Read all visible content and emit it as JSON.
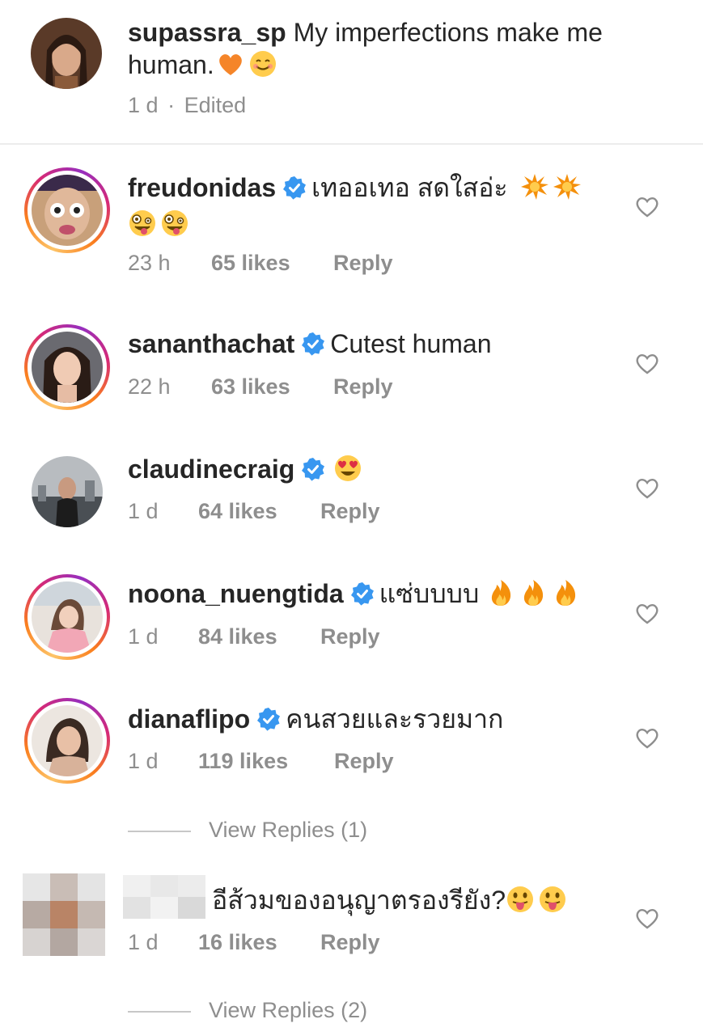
{
  "caption": {
    "username": "supassra_sp",
    "text_line1": "My imperfections make me",
    "text_line2": "human.",
    "time": "1 d",
    "separator": "·",
    "edited": "Edited"
  },
  "comments": [
    {
      "username": "freudonidas",
      "text_line1": "เทออเทอ สดใสอ่ะ",
      "time": "23 h",
      "likes": "65 likes",
      "reply": "Reply",
      "emojis": [
        "explosion-emoji",
        "explosion-emoji",
        "zany-face-emoji",
        "zany-face-emoji"
      ]
    },
    {
      "username": "sananthachat",
      "text": "Cutest human",
      "time": "22 h",
      "likes": "63 likes",
      "reply": "Reply"
    },
    {
      "username": "claudinecraig",
      "text": "",
      "time": "1 d",
      "likes": "64 likes",
      "reply": "Reply",
      "emojis": [
        "heart-eyes-emoji"
      ]
    },
    {
      "username": "noona_nuengtida",
      "text": "แซ่บบบบ",
      "time": "1 d",
      "likes": "84 likes",
      "reply": "Reply",
      "emojis": [
        "fire-emoji",
        "fire-emoji",
        "fire-emoji"
      ]
    },
    {
      "username": "dianaflipo",
      "text": "คนสวยและรวยมาก",
      "time": "1 d",
      "likes": "119 likes",
      "reply": "Reply",
      "view_replies": "View Replies (1)"
    },
    {
      "username": "",
      "text": "อีส้วมของอนุญาตรองรียัง?",
      "time": "1 d",
      "likes": "16 likes",
      "reply": "Reply",
      "emojis": [
        "tongue-out-emoji",
        "tongue-out-emoji"
      ],
      "view_replies": "View Replies (2)"
    }
  ],
  "colors": {
    "text": "#262626",
    "meta": "#8e8e8e",
    "verified": "#3897f0",
    "story_ring": [
      "#fdc468",
      "#fa7e1e",
      "#d62976",
      "#962fbf"
    ],
    "heart_caption": "#f58529",
    "divider": "#ececec"
  }
}
